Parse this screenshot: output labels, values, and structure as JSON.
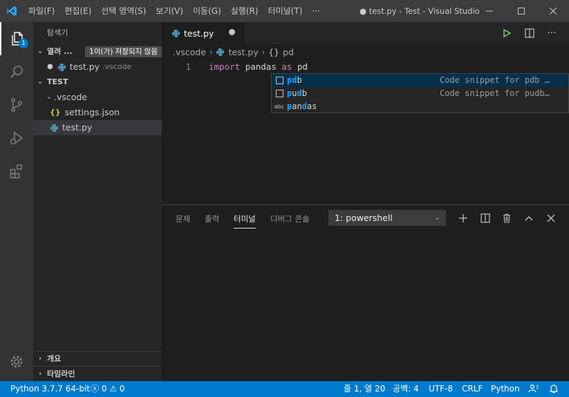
{
  "titlebar": {
    "menu": [
      "파일(F)",
      "편집(E)",
      "선택 영역(S)",
      "보기(V)",
      "이동(G)",
      "실행(R)",
      "터미널(T)",
      "···"
    ],
    "title": "● test.py - Test - Visual Studio"
  },
  "activity": {
    "explorer_badge": "1"
  },
  "sidebar": {
    "title": "탐색기",
    "open_editors_label": "열려 ...",
    "open_editors_badge": "1이(가) 저장되지 않음",
    "open_file_name": "test.py",
    "open_file_dir": ".vscode",
    "folder_label": "TEST",
    "tree": {
      "folder": ".vscode",
      "files": [
        "settings.json",
        "test.py"
      ]
    },
    "outline_label": "개요",
    "timeline_label": "타임라인"
  },
  "editor": {
    "tab_label": "test.py",
    "breadcrumb": [
      ".vscode",
      "test.py",
      "pd"
    ],
    "line_number": "1",
    "code": {
      "keyword1": "import",
      "module": "pandas",
      "keyword2": "as",
      "alias": "pd"
    }
  },
  "suggest": [
    {
      "label_hl": "pd",
      "label_rest": "b",
      "detail": "Code snippet for pdb …",
      "kind": "snippet"
    },
    {
      "label_hl1": "p",
      "label_mid": "u",
      "label_hl2": "d",
      "label_rest": "b",
      "detail": "Code snippet for pudb…",
      "kind": "snippet"
    },
    {
      "label_hl1": "p",
      "label_mid": "an",
      "label_hl2": "d",
      "label_rest": "as",
      "kind": "text",
      "kind_label": "abc"
    }
  ],
  "panel": {
    "tabs": [
      "문제",
      "출력",
      "터미널",
      "디버그 콘솔"
    ],
    "active_tab": "터미널",
    "terminal_select": "1: powershell"
  },
  "status": {
    "python": "Python 3.7.7 64-bit",
    "errors": "0",
    "warnings": "0",
    "position": "줄 1, 열 20",
    "spaces": "공백: 4",
    "encoding": "UTF-8",
    "eol": "CRLF",
    "language": "Python"
  },
  "colors": {
    "accent": "#007acc",
    "titlebar": "#3c3c3c",
    "sidebar": "#252526",
    "editor": "#1e1e1e",
    "keyword": "#c586c0",
    "match": "#18a3ff"
  }
}
